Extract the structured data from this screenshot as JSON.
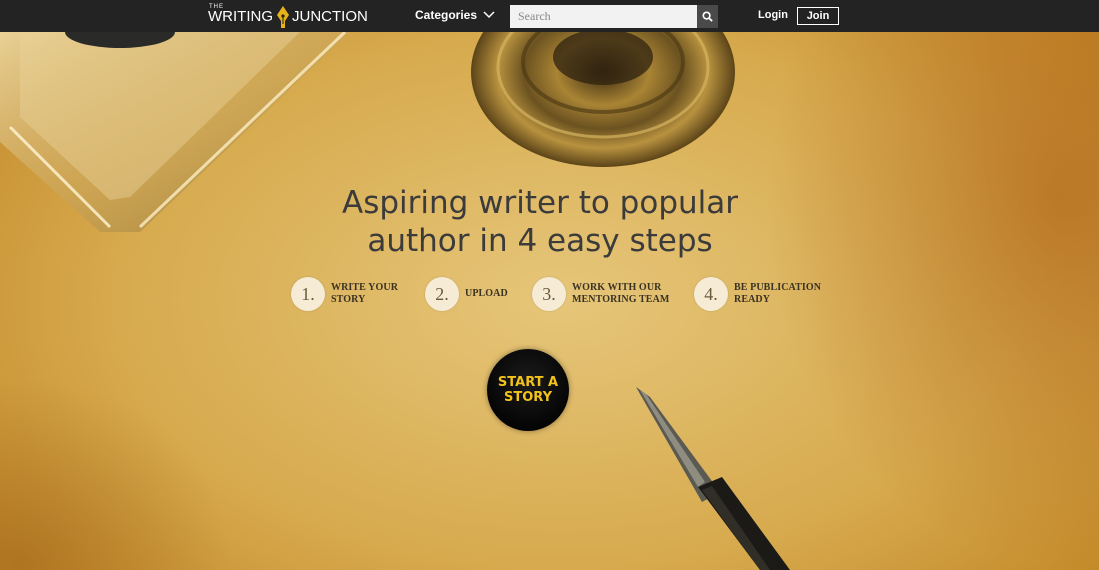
{
  "nav": {
    "logo_the": "THE",
    "logo_writing": "WRITING",
    "logo_junction": "JUNCTION",
    "categories_label": "Categories",
    "search_placeholder": "Search",
    "login_label": "Login",
    "join_label": "Join"
  },
  "hero": {
    "headline_line1": "Aspiring writer to popular",
    "headline_line2": "author in 4 easy steps",
    "steps": [
      {
        "number": "1.",
        "line1": "WRITE YOUR",
        "line2": "STORY"
      },
      {
        "number": "2.",
        "line1": "UPLOAD",
        "line2": ""
      },
      {
        "number": "3.",
        "line1": "WORK WITH OUR",
        "line2": "MENTORING TEAM"
      },
      {
        "number": "4.",
        "line1": "BE PUBLICATION",
        "line2": "READY"
      }
    ],
    "cta_line1": "START A",
    "cta_line2": "STORY"
  },
  "colors": {
    "navbar": "#232323",
    "cta_text": "#f3c21b",
    "logo_accent": "#e8b21a"
  }
}
